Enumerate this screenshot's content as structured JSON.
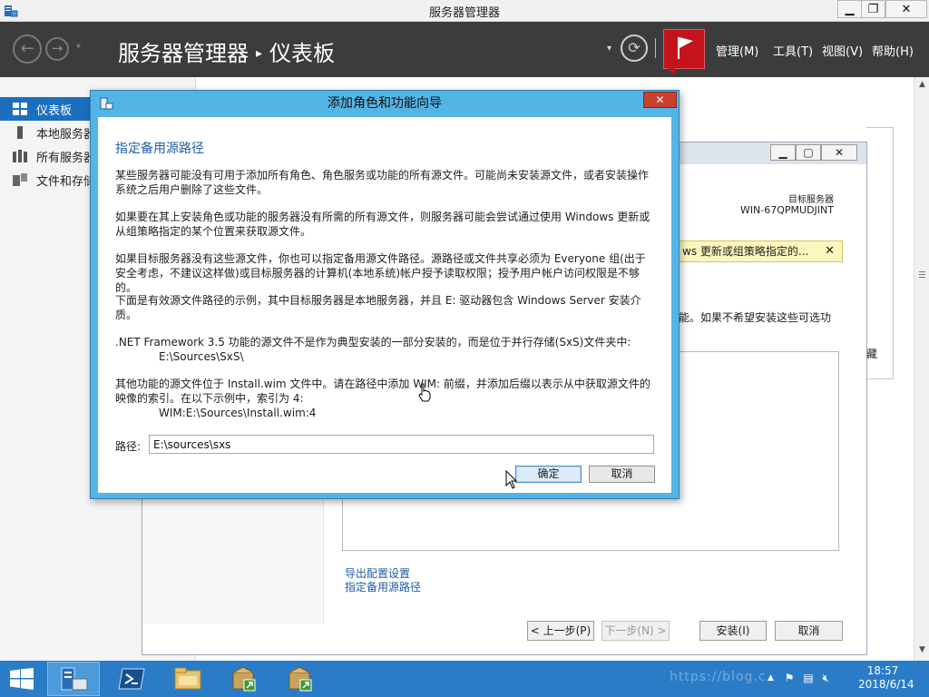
{
  "window": {
    "title": "服务器管理器",
    "min": "▁",
    "max": "❐",
    "close": "✕"
  },
  "header": {
    "breadcrumb_root": "服务器管理器",
    "breadcrumb_sep": "▸",
    "breadcrumb_page": "仪表板",
    "menus": [
      "管理(M)",
      "工具(T)",
      "视图(V)",
      "帮助(H)"
    ]
  },
  "nav": {
    "items": [
      {
        "label": "仪表板"
      },
      {
        "label": "本地服务器"
      },
      {
        "label": "所有服务器"
      },
      {
        "label": "文件和存储服务"
      }
    ]
  },
  "bg_wizard": {
    "target_label": "目标服务器",
    "target_value": "WIN-67QPMUDJINT",
    "warning_text": "ws 更新或组策略指定的...",
    "warning_close": "✕",
    "partial_text_1": "能。如果不希望安装这些可选功",
    "partial_text_2": "藏",
    "links": [
      "导出配置设置",
      "指定备用源路径"
    ],
    "btn_prev": "< 上一步(P)",
    "btn_next": "下一步(N) >",
    "btn_install": "安装(I)",
    "btn_cancel": "取消"
  },
  "dialog": {
    "title": "添加角色和功能向导",
    "close": "✕",
    "heading": "指定备用源路径",
    "para1": "某些服务器可能没有可用于添加所有角色、角色服务或功能的所有源文件。可能尚未安装源文件，或者安装操作系统之后用户删除了这些文件。",
    "para2": "如果要在其上安装角色或功能的服务器没有所需的所有源文件，则服务器可能会尝试通过使用 Windows 更新或从组策略指定的某个位置来获取源文件。",
    "para3": "如果目标服务器没有这些源文件，你也可以指定备用源文件路径。源路径或文件共享必须为 Everyone 组(出于安全考虑，不建议这样做)或目标服务器的计算机(本地系统)帐户授予读取权限；授予用户帐户访问权限是不够的。",
    "para4": "下面是有效源文件路径的示例，其中目标服务器是本地服务器，并且 E: 驱动器包含 Windows Server 安装介质。",
    "para5": ".NET Framework 3.5 功能的源文件不是作为典型安装的一部分安装的，而是位于并行存储(SxS)文件夹中:",
    "para5_example": "E:\\Sources\\SxS\\",
    "para6": "其他功能的源文件位于 Install.wim 文件中。请在路径中添加 WIM: 前缀，并添加后缀以表示从中获取源文件的映像的索引。在以下示例中，索引为 4:",
    "para6_example": "WIM:E:\\Sources\\Install.wim:4",
    "path_label": "路径:",
    "path_value": "E:\\sources\\sxs",
    "ok": "确定",
    "cancel": "取消"
  },
  "taskbar": {
    "clock_time": "18:57",
    "clock_date": "2018/6/14",
    "watermark": "https://blog.c"
  }
}
